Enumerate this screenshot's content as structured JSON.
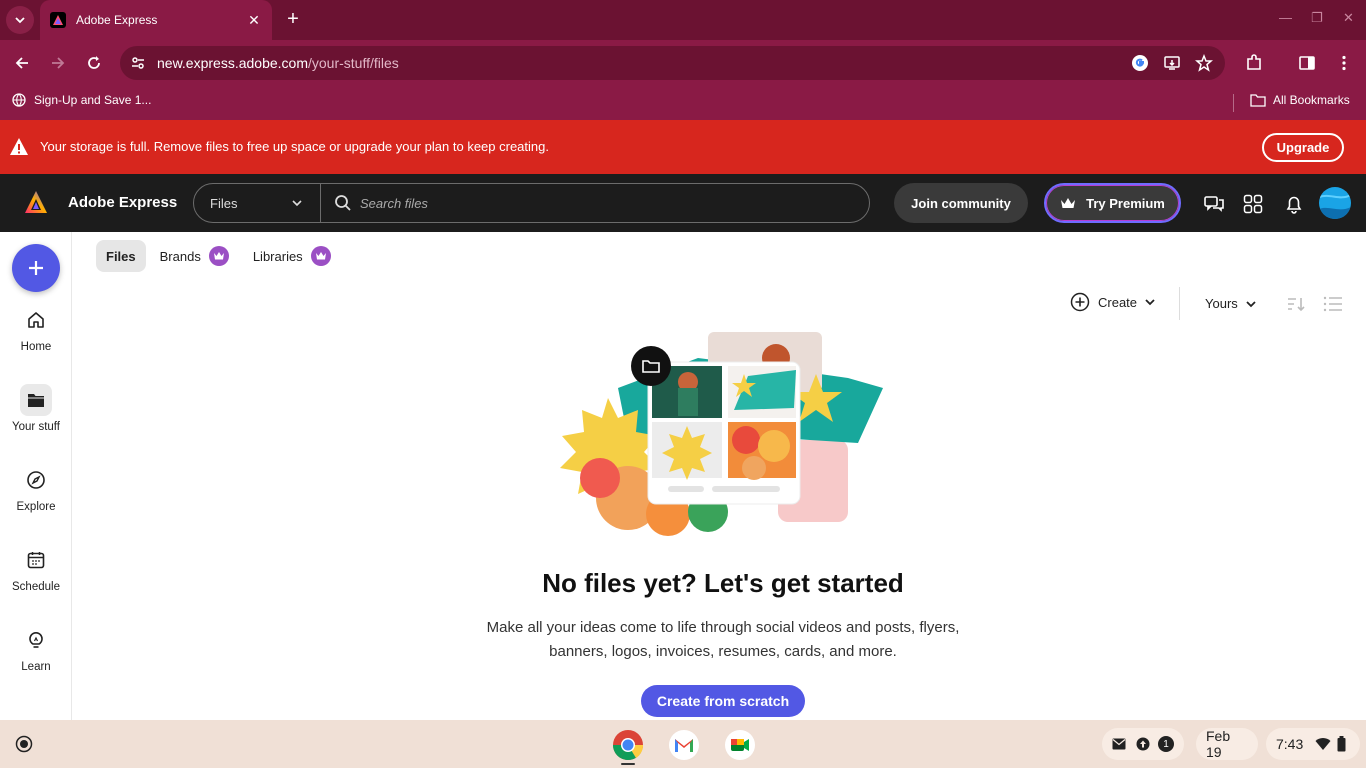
{
  "browser": {
    "tab_title": "Adobe Express",
    "url_host": "new.express.adobe.com",
    "url_path": "/your-stuff/files",
    "bookmarks": [
      "Sign-Up and Save 1..."
    ],
    "all_bookmarks_label": "All Bookmarks",
    "theme_color": "#8a1a45"
  },
  "banner": {
    "message": "Your storage is full. Remove files to free up space or upgrade your plan to keep creating.",
    "upgrade_label": "Upgrade",
    "color": "#d7261e"
  },
  "header": {
    "app_name": "Adobe Express",
    "search_scope": "Files",
    "search_placeholder": "Search files",
    "join_community_label": "Join community",
    "try_premium_label": "Try Premium",
    "icons": [
      "chat-icon",
      "apps-grid-icon",
      "bell-icon",
      "avatar"
    ]
  },
  "rail": {
    "items": [
      {
        "label": "Home",
        "icon": "home-icon"
      },
      {
        "label": "Your stuff",
        "icon": "folder-icon",
        "active": true
      },
      {
        "label": "Explore",
        "icon": "compass-icon"
      },
      {
        "label": "Schedule",
        "icon": "calendar-icon"
      },
      {
        "label": "Learn",
        "icon": "lightbulb-icon"
      }
    ]
  },
  "subtabs": [
    {
      "label": "Files",
      "active": true
    },
    {
      "label": "Brands",
      "premium": true
    },
    {
      "label": "Libraries",
      "premium": true
    }
  ],
  "controls": {
    "create_label": "Create",
    "owner_label": "Yours"
  },
  "empty_state": {
    "title": "No files yet? Let's get started",
    "description_line1": "Make all your ideas come to life through social videos and posts, flyers,",
    "description_line2": "banners, logos, invoices, resumes, cards, and more.",
    "cta_label": "Create from scratch",
    "accent_color": "#5258e4"
  },
  "shelf": {
    "apps": [
      "chrome-icon",
      "gmail-icon",
      "meet-icon"
    ],
    "notification_count": "1",
    "date": "Feb 19",
    "time": "7:43"
  }
}
